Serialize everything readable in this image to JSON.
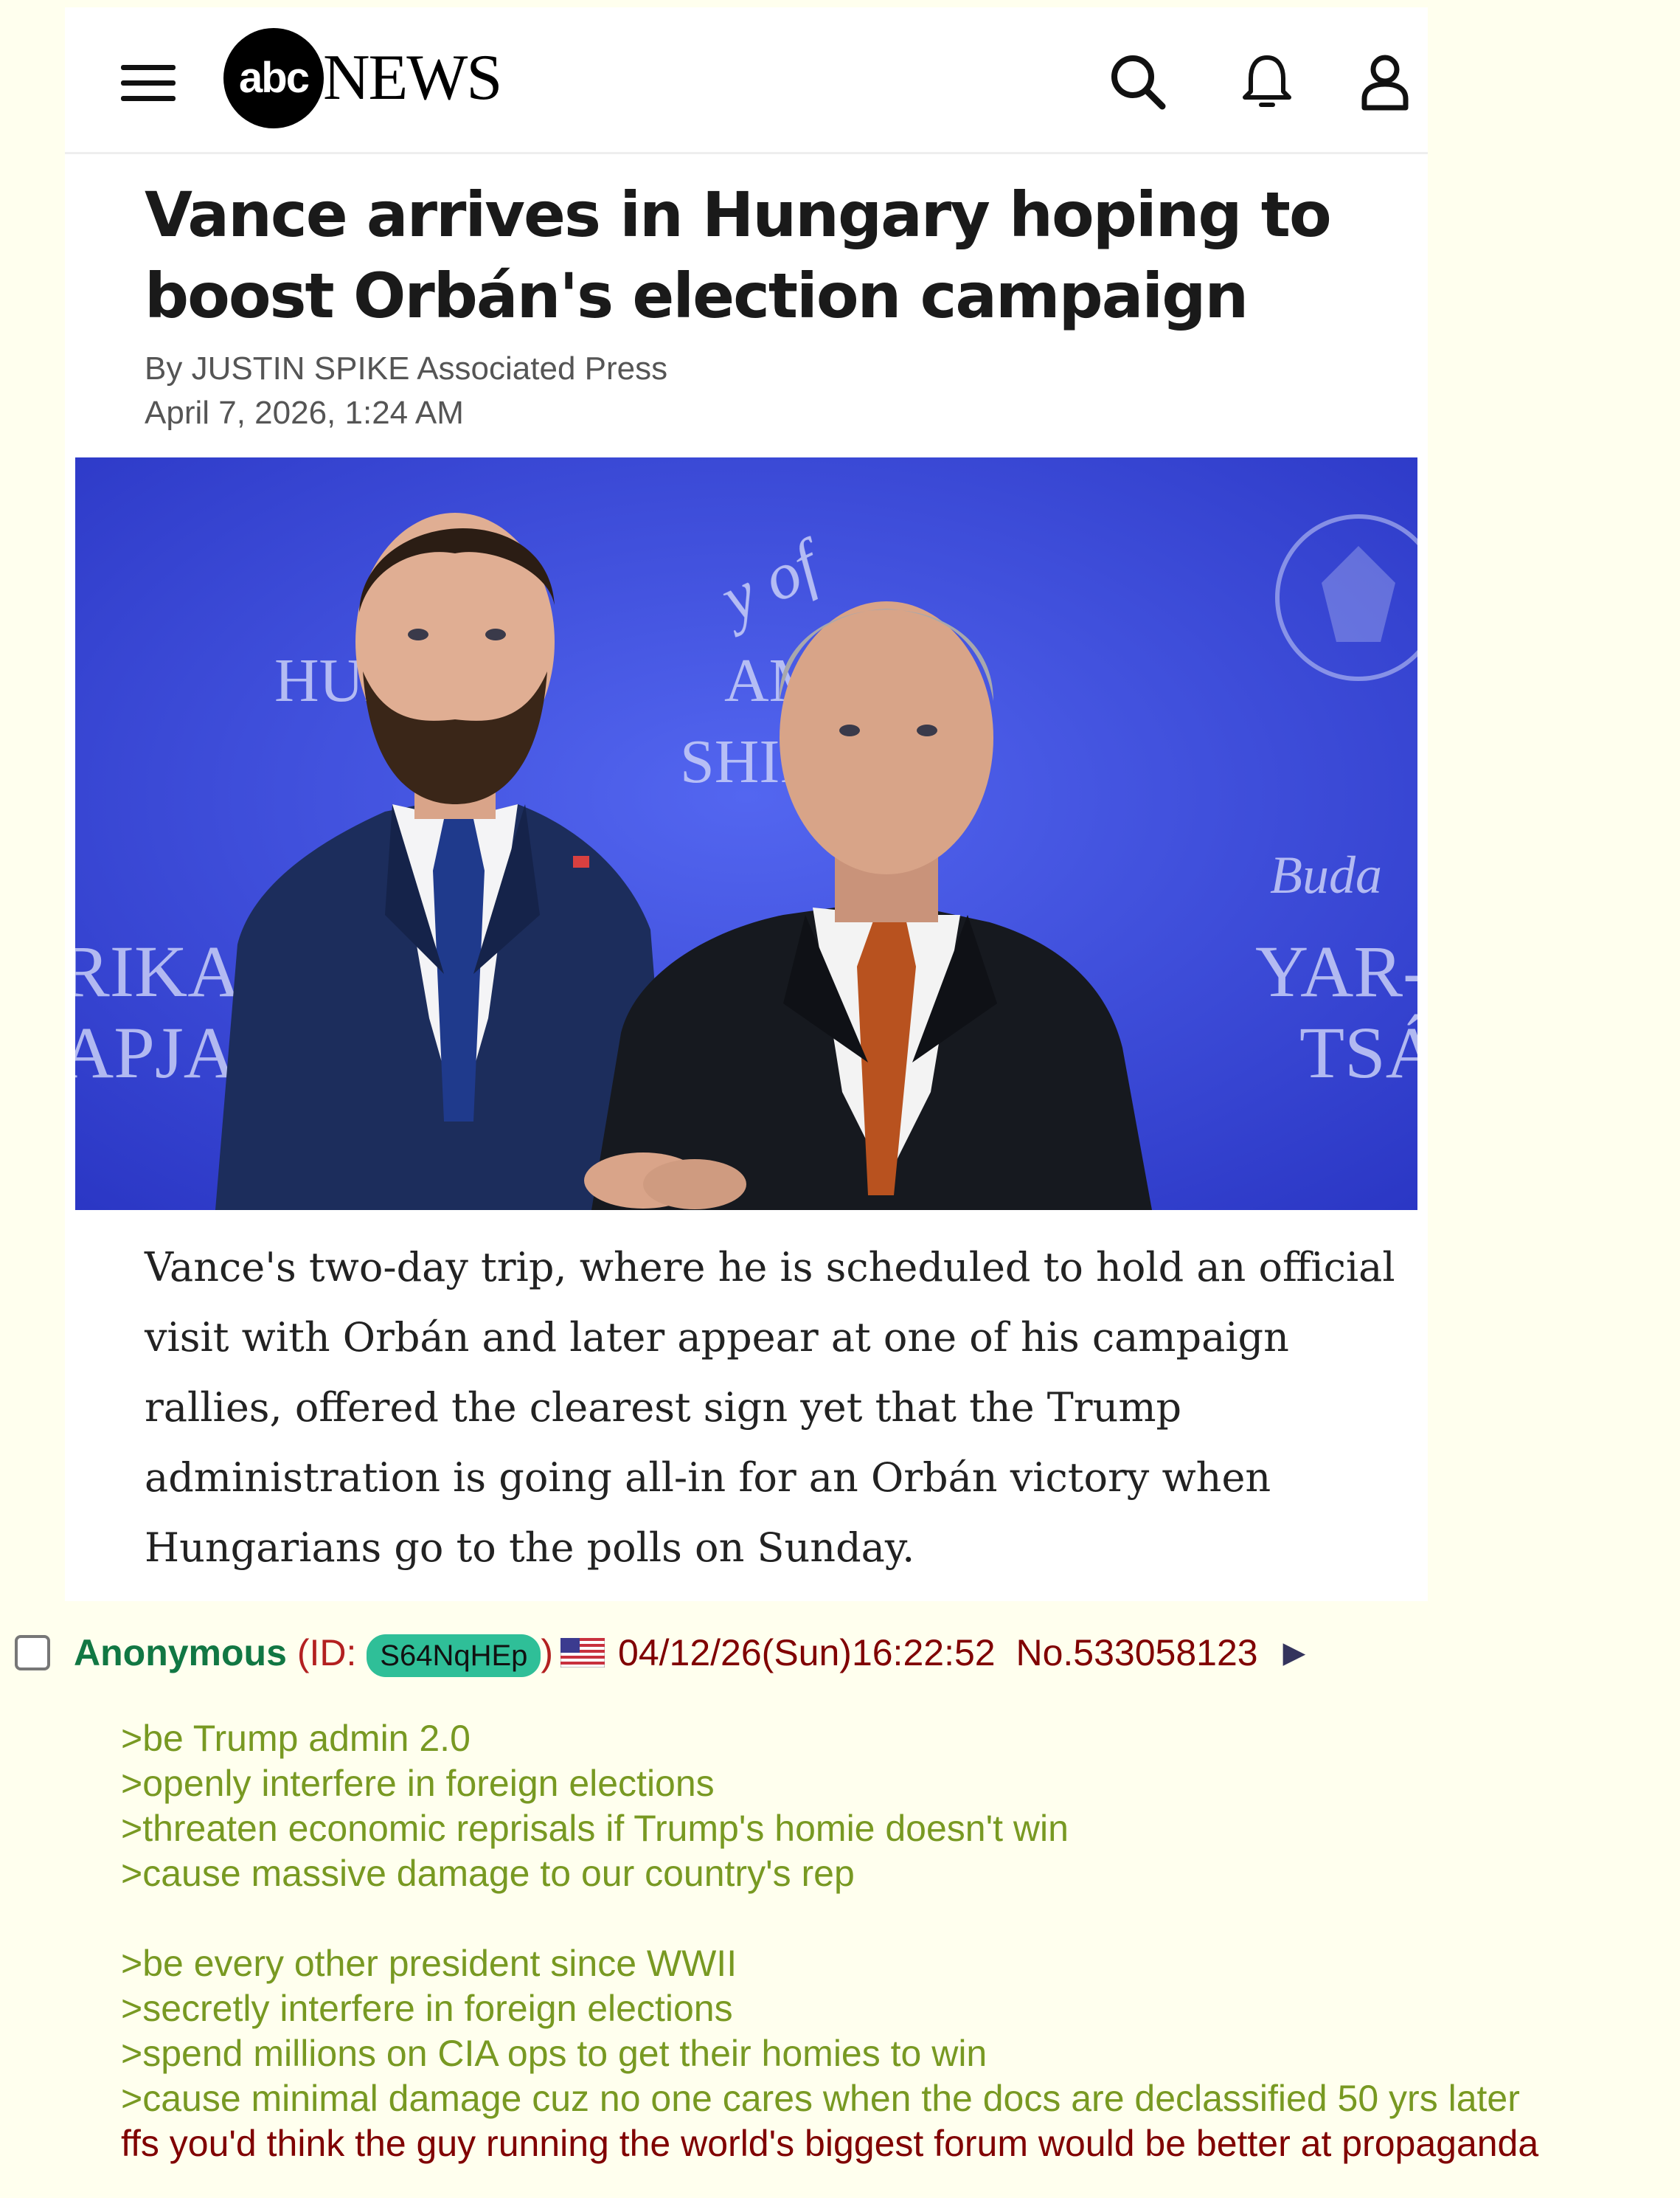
{
  "article": {
    "brand": {
      "logo_circle": "abc",
      "logo_text": "NEWS"
    },
    "icons": [
      "hamburger-menu-icon",
      "search-icon",
      "bell-icon",
      "user-icon"
    ],
    "headline": "Vance arrives in Hungary hoping to boost Orbán's election campaign",
    "byline": "By JUSTIN SPIKE Associated Press",
    "date": "April 7, 2026, 1:24 AM",
    "photo": {
      "background_text_left_top": "HUNGA",
      "background_text_mid": "AME",
      "background_text_ship": "SHIP",
      "background_text_left_1": "RIKA",
      "background_text_left_2": "APJA",
      "background_text_right_1": "Buda",
      "background_text_right_2": "YAR-A",
      "background_text_right_3": "TSÁ",
      "background_script": "y of"
    },
    "caption": "Vance's two-day trip, where he is scheduled to hold an official visit with Orbán and later appear at one of his campaign rallies, offered the clearest sign yet that the Trump administration is going all-in for an Orbán victory when Hungarians go to the polls on Sunday."
  },
  "post": {
    "name": "Anonymous",
    "id_prefix": "(ID:",
    "id": "S64NqHEp",
    "id_suffix": ")",
    "datetime": "04/12/26(Sun)16:22:52",
    "number": "No.533058123",
    "arrow": "▶",
    "colors": {
      "name": "#117743",
      "greentext": "#789922",
      "text": "#800000",
      "id_bg": "#2fbf98",
      "background": "#ffffee"
    },
    "lines_group1": [
      ">be Trump admin 2.0",
      ">openly interfere in foreign elections",
      ">threaten economic reprisals if Trump's homie doesn't win",
      ">cause massive damage to our country's rep"
    ],
    "lines_group2": [
      ">be every other president since WWII",
      ">secretly interfere in foreign elections",
      ">spend millions on CIA ops to get their homies to win",
      ">cause minimal damage cuz no one cares when the docs are declassified 50 yrs later"
    ],
    "final_line": "ffs you'd think the guy running the world's biggest forum would be better at propaganda"
  }
}
